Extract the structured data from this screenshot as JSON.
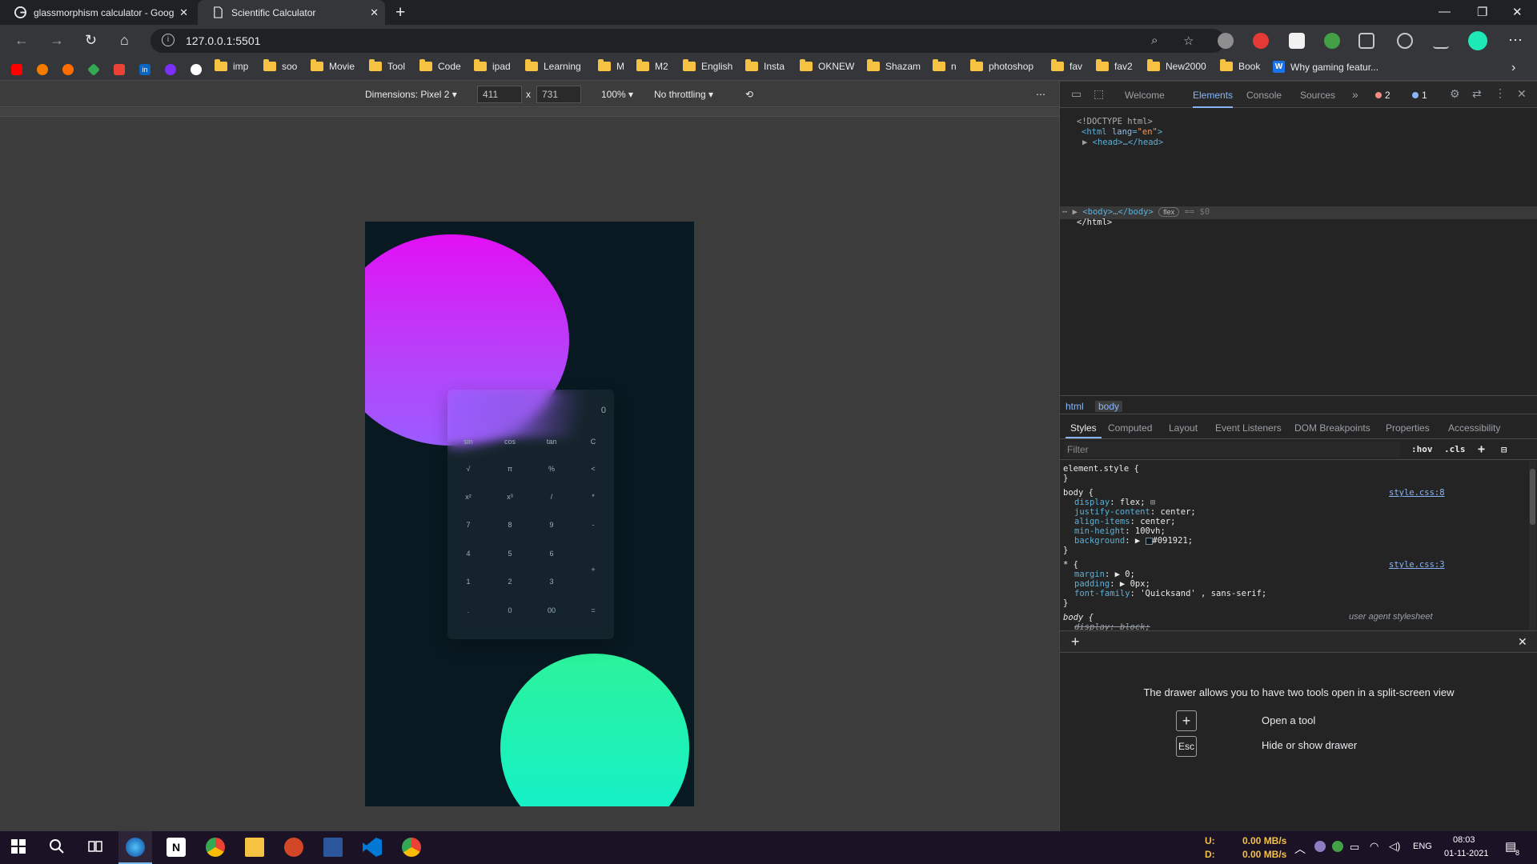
{
  "browser": {
    "tabs": [
      {
        "title": "glassmorphism calculator - Goog"
      },
      {
        "title": "Scientific Calculator"
      }
    ],
    "url": "127.0.0.1:5501",
    "bookmarks": [
      "imp",
      "soo",
      "Movie",
      "Tool",
      "Code",
      "ipad",
      "Learning",
      "M",
      "M2",
      "English",
      "Insta",
      "OKNEW",
      "Shazam",
      "n",
      "photoshop",
      "fav",
      "fav2",
      "New2000",
      "Book"
    ],
    "bookmark_last": "Why gaming featur..."
  },
  "device_toolbar": {
    "dimensions_label": "Dimensions: Pixel 2",
    "width": "411",
    "times": "x",
    "height": "731",
    "zoom": "100%",
    "throttling": "No throttling"
  },
  "calculator": {
    "display": "0",
    "keys": [
      [
        "sin",
        "cos",
        "tan",
        "C"
      ],
      [
        "√",
        "π",
        "%",
        "<"
      ],
      [
        "x²",
        "x³",
        "/",
        "*"
      ],
      [
        "7",
        "8",
        "9",
        "-"
      ],
      [
        "4",
        "5",
        "6",
        "+"
      ],
      [
        "1",
        "2",
        "3",
        ""
      ],
      [
        ".",
        "0",
        "00",
        "="
      ]
    ]
  },
  "devtools": {
    "tabs": [
      "Welcome",
      "Elements",
      "Console",
      "Sources"
    ],
    "error_count": "2",
    "info_count": "1",
    "dom": {
      "doctype": "<!DOCTYPE html>",
      "html_open": "<html",
      "lang_attr": "lang",
      "lang_val": "\"en\"",
      "head": "<head>…</head>",
      "body": "<body>…</body>",
      "body_badge": "flex",
      "body_eq": "== $0",
      "html_close": "</html>"
    },
    "breadcrumbs": [
      "html",
      "body"
    ],
    "style_tabs": [
      "Styles",
      "Computed",
      "Layout",
      "Event Listeners",
      "DOM Breakpoints",
      "Properties",
      "Accessibility"
    ],
    "filter_placeholder": "Filter",
    "hov": ":hov",
    "cls": ".cls",
    "styles": {
      "element_style": "element.style {",
      "close": "}",
      "body_sel": "body {",
      "body_source": "style.css:8",
      "display": "display",
      "display_val": "flex;",
      "justify": "justify-content",
      "justify_val": "center;",
      "align": "align-items",
      "align_val": "center;",
      "minh": "min-height",
      "minh_val": "100vh;",
      "bg": "background",
      "bg_val": "#091921;",
      "star_sel": "* {",
      "star_source": "style.css:3",
      "margin": "margin",
      "margin_val": "0;",
      "padding": "padding",
      "padding_val": "0px;",
      "ff": "font-family",
      "ff_val": "'Quicksand' , sans-serif;",
      "ua_sel": "body {",
      "ua_label": "user agent stylesheet",
      "ua_display": "display: block;"
    },
    "drawer": {
      "message": "The drawer allows you to have two tools open in a split-screen view",
      "open_tool": "Open a tool",
      "esc_key": "Esc",
      "hide_show": "Hide or show drawer"
    }
  },
  "taskbar": {
    "up_label": "U:",
    "down_label": "D:",
    "up_rate": "0.00 MB/s",
    "down_rate": "0.00 MB/s",
    "lang": "ENG",
    "time": "08:03",
    "date": "01-11-2021",
    "notif_count": "8"
  }
}
